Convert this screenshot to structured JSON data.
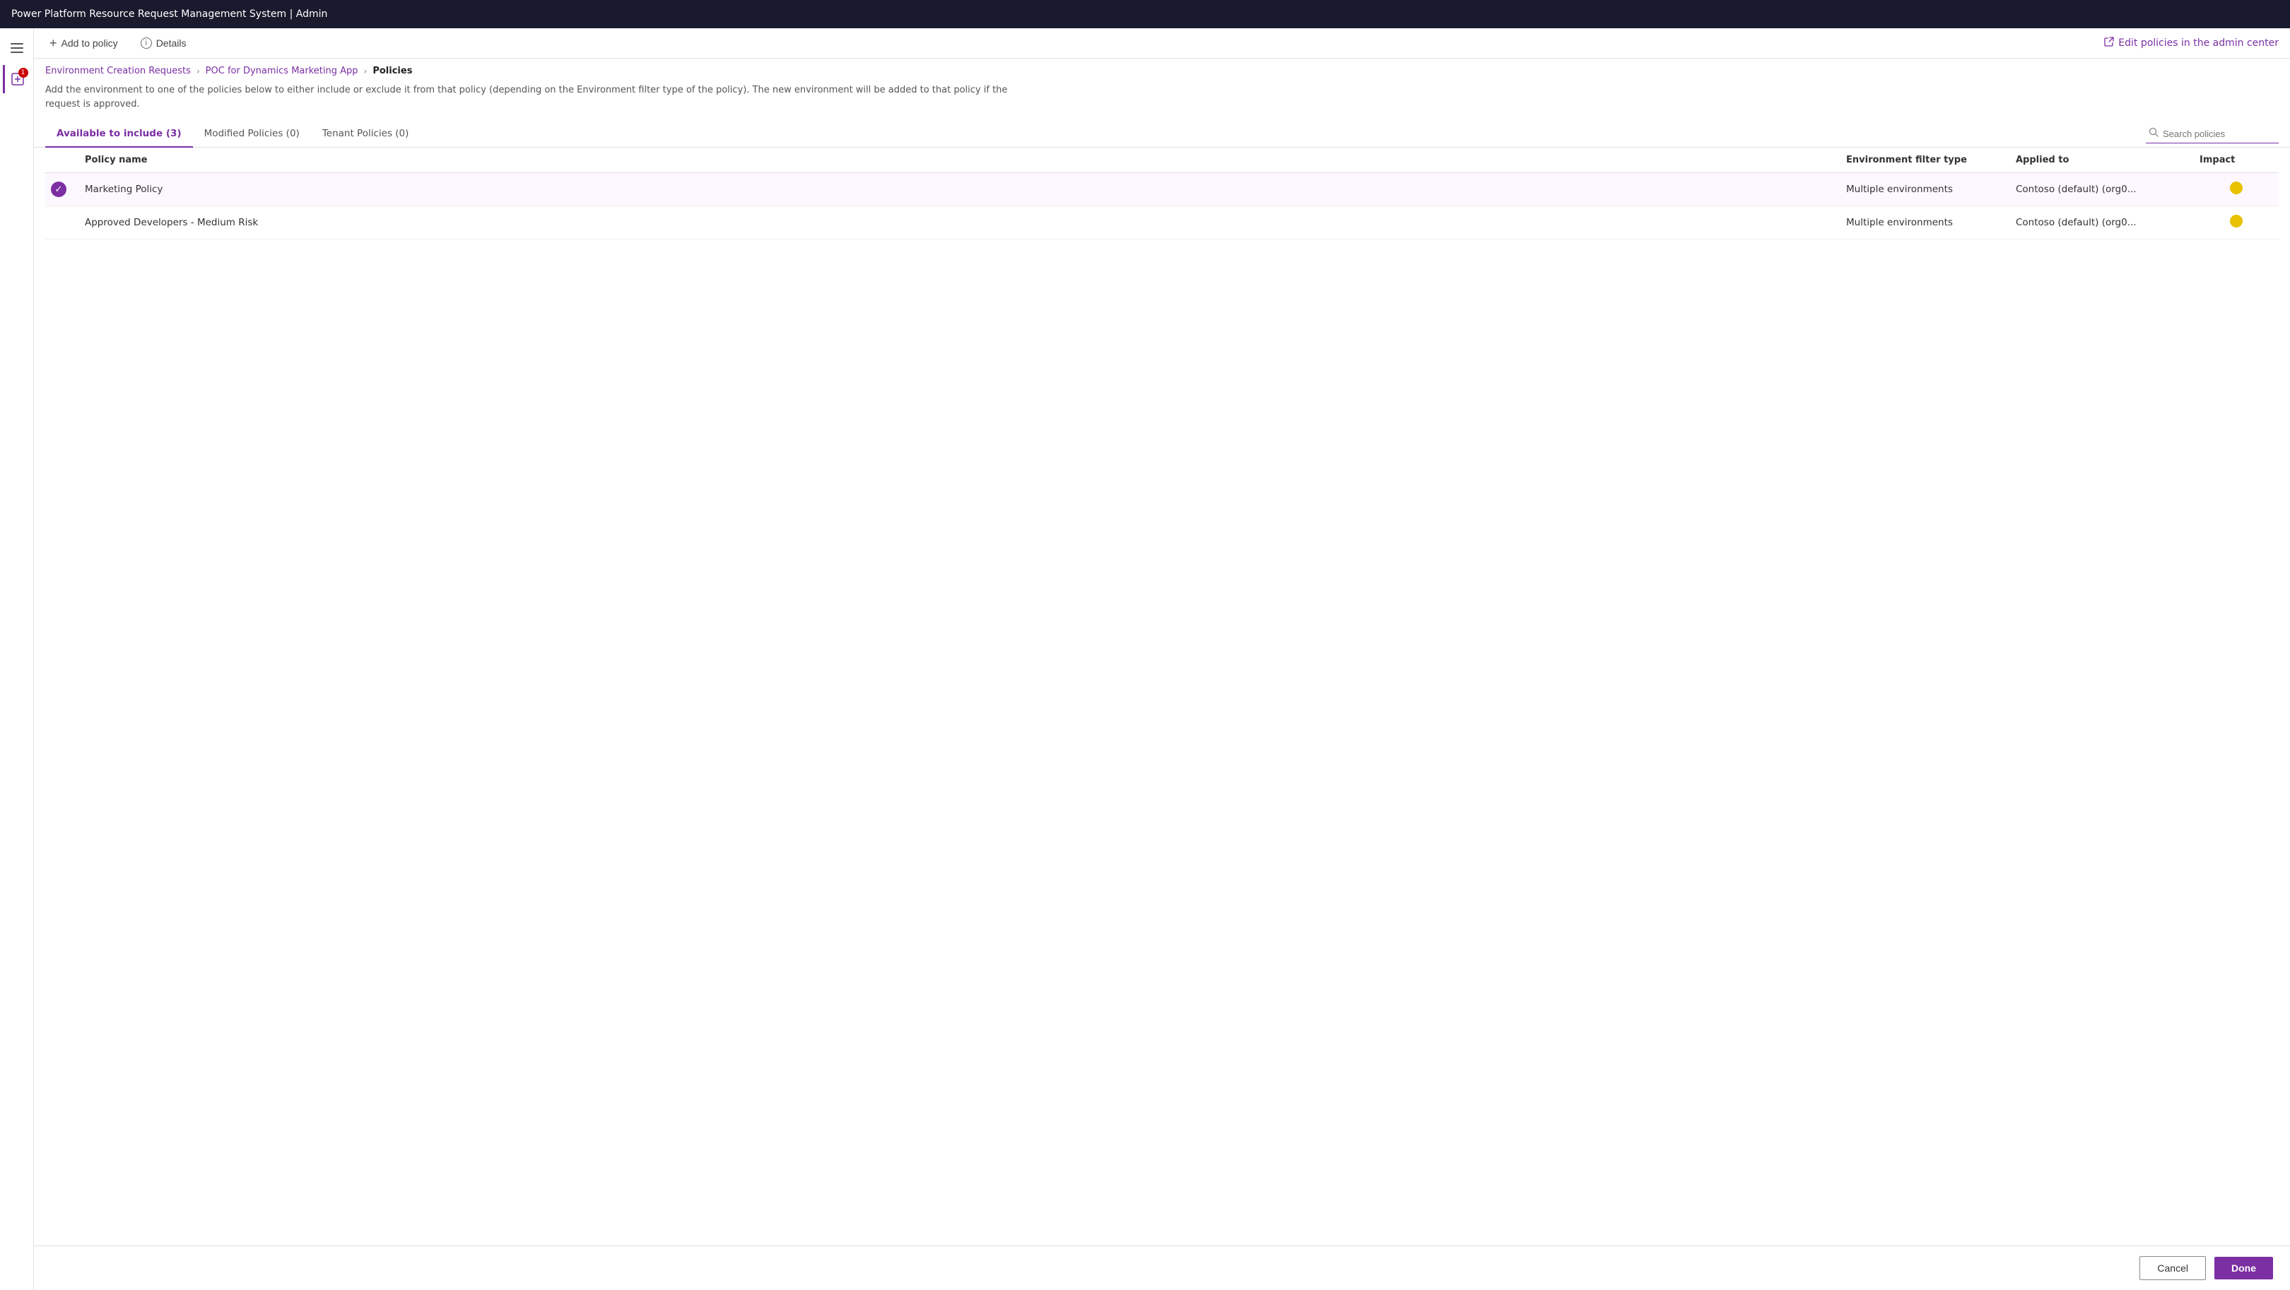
{
  "titleBar": {
    "title": "Power Platform Resource Request Management System | Admin"
  },
  "toolbar": {
    "addToPolicy": "Add to policy",
    "details": "Details",
    "editPolicies": "Edit policies in the admin center"
  },
  "breadcrumb": {
    "items": [
      {
        "label": "Environment Creation Requests",
        "active": false
      },
      {
        "label": "POC for Dynamics Marketing App",
        "active": false
      },
      {
        "label": "Policies",
        "active": true
      }
    ]
  },
  "description": "Add the environment to one of the policies below to either include or exclude it from that policy (depending on the Environment filter type of the policy). The new environment will be added to that policy if the request is approved.",
  "tabs": [
    {
      "label": "Available to include (3)",
      "active": true
    },
    {
      "label": "Modified Policies (0)",
      "active": false
    },
    {
      "label": "Tenant Policies (0)",
      "active": false
    }
  ],
  "search": {
    "placeholder": "Search policies"
  },
  "table": {
    "columns": [
      {
        "key": "check",
        "label": ""
      },
      {
        "key": "policy_name",
        "label": "Policy name"
      },
      {
        "key": "env_filter",
        "label": "Environment filter type"
      },
      {
        "key": "applied_to",
        "label": "Applied to"
      },
      {
        "key": "impact",
        "label": "Impact"
      }
    ],
    "rows": [
      {
        "selected": true,
        "policy_name": "Marketing Policy",
        "env_filter": "Multiple environments",
        "applied_to": "Contoso (default) (org0...",
        "impact_color": "yellow"
      },
      {
        "selected": false,
        "policy_name": "Approved Developers - Medium Risk",
        "env_filter": "Multiple environments",
        "applied_to": "Contoso (default) (org0...",
        "impact_color": "yellow"
      }
    ]
  },
  "footer": {
    "cancel": "Cancel",
    "done": "Done"
  },
  "sidebar": {
    "notificationCount": "1"
  }
}
